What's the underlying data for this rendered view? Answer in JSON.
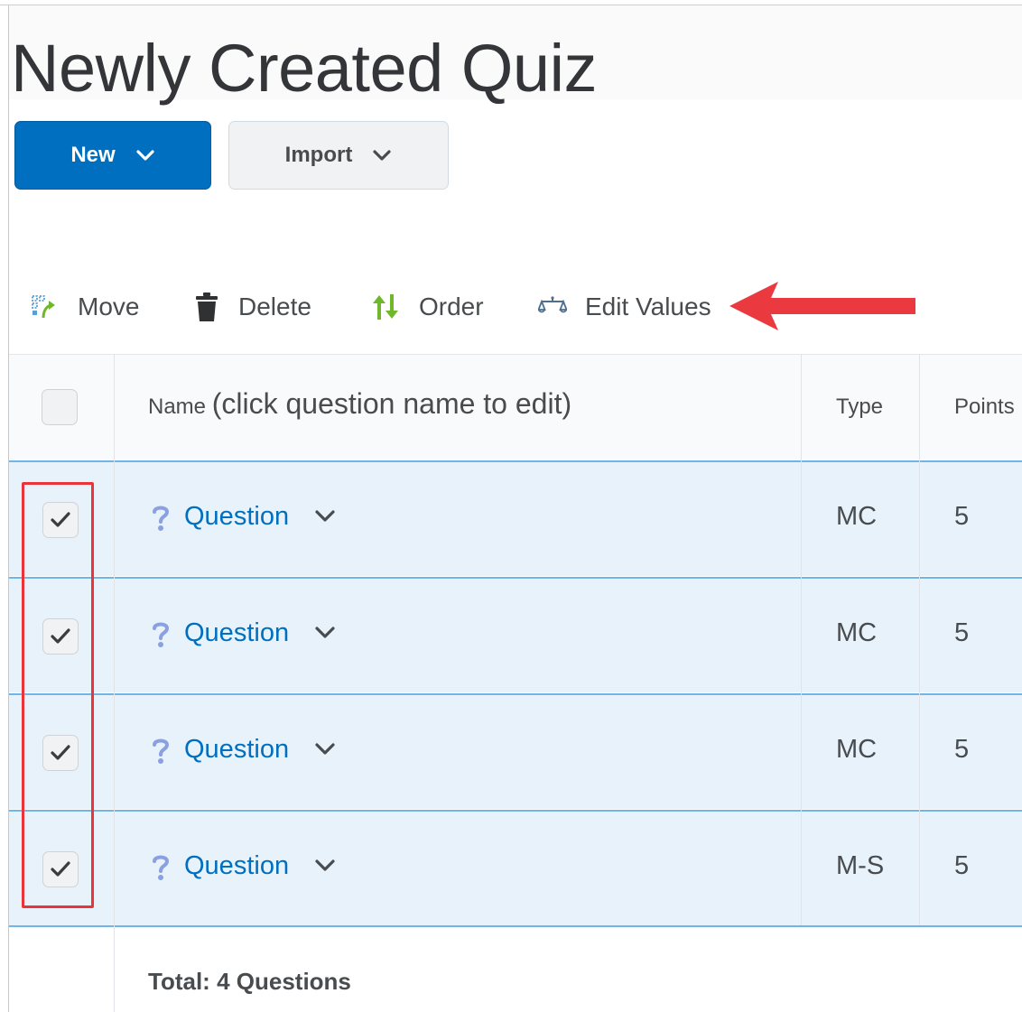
{
  "page": {
    "title": "Newly Created Quiz"
  },
  "buttons": {
    "new_label": "New",
    "import_label": "Import"
  },
  "toolbar": {
    "move_label": "Move",
    "delete_label": "Delete",
    "order_label": "Order",
    "edit_values_label": "Edit Values"
  },
  "table": {
    "headers": {
      "name": "Name",
      "name_hint": "(click question name to edit)",
      "type": "Type",
      "points": "Points"
    },
    "rows": [
      {
        "name": "Question",
        "type": "MC",
        "points": "5",
        "checked": true
      },
      {
        "name": "Question",
        "type": "MC",
        "points": "5",
        "checked": true
      },
      {
        "name": "Question",
        "type": "MC",
        "points": "5",
        "checked": true
      },
      {
        "name": "Question",
        "type": "M-S",
        "points": "5",
        "checked": true
      }
    ],
    "total_label": "Total:",
    "total_value": "4 Questions"
  },
  "colors": {
    "primary": "#006fbf",
    "row_selected": "#e8f2fb",
    "annotation_red": "#e8343a"
  }
}
